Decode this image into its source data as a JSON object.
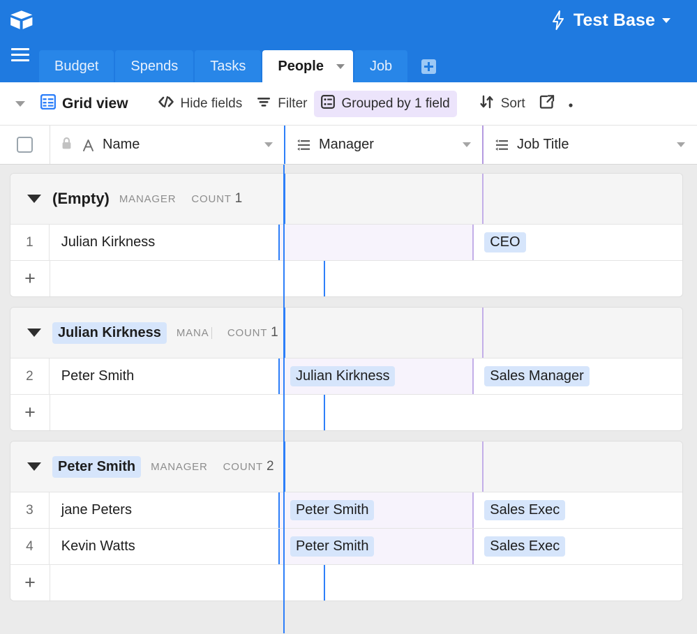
{
  "topbar": {
    "logo_icon": "airtable-cube-logo",
    "bolt_icon": "lightning-bolt-icon",
    "base_name": "Test Base",
    "base_caret_icon": "chevron-down-icon"
  },
  "tabbar": {
    "menu_icon": "hamburger-menu-icon",
    "add_icon": "plus-icon",
    "tabs": [
      {
        "label": "Budget",
        "active": false
      },
      {
        "label": "Spends",
        "active": false
      },
      {
        "label": "Tasks",
        "active": false
      },
      {
        "label": "People",
        "active": true
      },
      {
        "label": "Job",
        "active": false
      }
    ]
  },
  "toolbar": {
    "collapse_caret_icon": "caret-down-icon",
    "grid_icon": "grid-view-icon",
    "view_name": "Grid view",
    "hide_fields_icon": "code-brackets-icon",
    "hide_fields_label": "Hide fields",
    "filter_icon": "filter-icon",
    "filter_label": "Filter",
    "group_icon": "group-list-icon",
    "group_label": "Grouped by 1 field",
    "group_active_color": "#ece4fb",
    "sort_icon": "sort-arrows-icon",
    "sort_label": "Sort",
    "share_icon": "share-external-icon",
    "more_icon": "more-dots-icon"
  },
  "grid": {
    "select_all_checkbox_icon": "checkbox-icon",
    "columns": [
      {
        "name": "Name",
        "icon": "text-field-A-icon",
        "lock_icon": "lock-icon",
        "menu_icon": "chevron-down-icon"
      },
      {
        "name": "Manager",
        "icon": "select-field-icon",
        "menu_icon": "chevron-down-icon"
      },
      {
        "name": "Job Title",
        "icon": "select-field-icon",
        "menu_icon": "chevron-down-icon"
      }
    ],
    "field_label": "MANAGER",
    "field_label_truncated": "MANA",
    "count_label": "COUNT",
    "add_row_icon": "plus-icon",
    "frozen_divider_color": "#2d7ff9",
    "group_divider_color": "#c3aee8",
    "chip_color": "#d6e5fb",
    "groups": [
      {
        "name": "(Empty)",
        "is_empty": true,
        "field": "MANAGER",
        "count": "1",
        "rows": [
          {
            "num": "1",
            "name": "Julian Kirkness",
            "manager": "",
            "job": "CEO"
          }
        ]
      },
      {
        "name": "Julian Kirkness",
        "is_empty": false,
        "field": "MANA",
        "count": "1",
        "rows": [
          {
            "num": "2",
            "name": "Peter Smith",
            "manager": "Julian Kirkness",
            "job": "Sales Manager"
          }
        ]
      },
      {
        "name": "Peter Smith",
        "is_empty": false,
        "field": "MANAGER",
        "count": "2",
        "rows": [
          {
            "num": "3",
            "name": "jane Peters",
            "manager": "Peter Smith",
            "job": "Sales Exec"
          },
          {
            "num": "4",
            "name": "Kevin Watts",
            "manager": "Peter Smith",
            "job": "Sales Exec"
          }
        ]
      }
    ]
  }
}
